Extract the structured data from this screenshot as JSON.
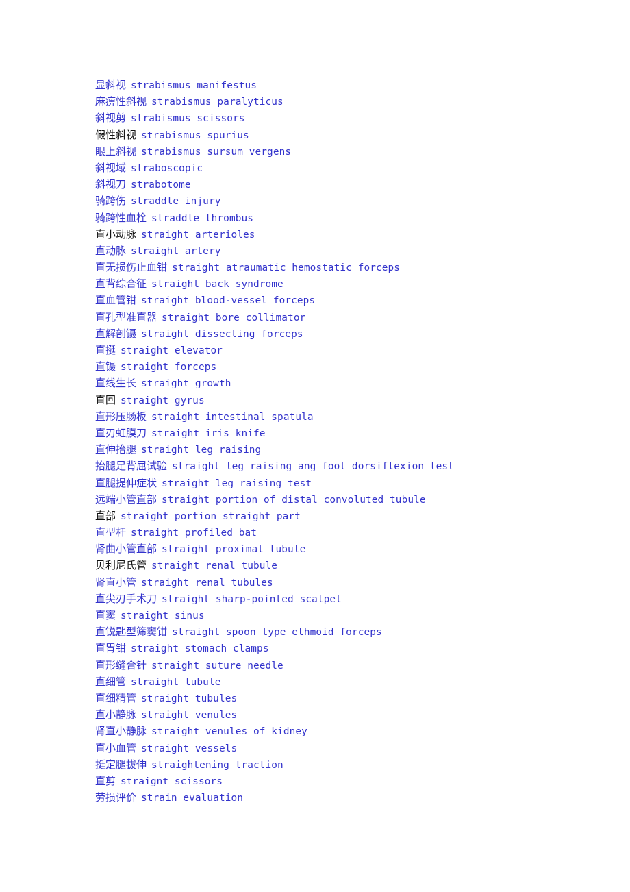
{
  "document": {
    "type": "bilingual-glossary",
    "language_pair": "Chinese-English",
    "text_color_blue": "#3333CC",
    "text_color_black": "#111111",
    "background_color": "#FFFFFF",
    "entry_count": 44
  },
  "entries": [
    {
      "term": "显斜视",
      "term_color": "blue",
      "gloss": "strabismus manifestus"
    },
    {
      "term": "麻痹性斜视",
      "term_color": "blue",
      "gloss": "strabismus paralyticus"
    },
    {
      "term": "斜视剪",
      "term_color": "blue",
      "gloss": "strabismus scissors"
    },
    {
      "term": "假性斜视",
      "term_color": "black",
      "gloss": "strabismus spurius"
    },
    {
      "term": "眼上斜视",
      "term_color": "blue",
      "gloss": "strabismus sursum vergens"
    },
    {
      "term": "斜视域",
      "term_color": "blue",
      "gloss": "straboscopic"
    },
    {
      "term": "斜视刀",
      "term_color": "blue",
      "gloss": "strabotome"
    },
    {
      "term": "骑跨伤",
      "term_color": "blue",
      "gloss": "straddle injury"
    },
    {
      "term": "骑跨性血栓",
      "term_color": "blue",
      "gloss": "straddle thrombus"
    },
    {
      "term": "直小动脉",
      "term_color": "black",
      "gloss": "straight arterioles"
    },
    {
      "term": "直动脉",
      "term_color": "blue",
      "gloss": "straight artery"
    },
    {
      "term": "直无损伤止血钳",
      "term_color": "blue",
      "gloss": "straight atraumatic hemostatic forceps"
    },
    {
      "term": "直背综合征",
      "term_color": "blue",
      "gloss": "straight back syndrome"
    },
    {
      "term": "直血管钳",
      "term_color": "blue",
      "gloss": "straight blood-vessel forceps"
    },
    {
      "term": "直孔型准直器",
      "term_color": "blue",
      "gloss": "straight bore collimator"
    },
    {
      "term": "直解剖镊",
      "term_color": "blue",
      "gloss": "straight dissecting forceps"
    },
    {
      "term": "直挺",
      "term_color": "blue",
      "gloss": "straight elevator"
    },
    {
      "term": "直镊",
      "term_color": "blue",
      "gloss": "straight forceps"
    },
    {
      "term": "直线生长",
      "term_color": "blue",
      "gloss": "straight growth"
    },
    {
      "term": "直回",
      "term_color": "black",
      "gloss": "straight gyrus"
    },
    {
      "term": "直形压肠板",
      "term_color": "blue",
      "gloss": "straight intestinal spatula"
    },
    {
      "term": "直刃虹膜刀",
      "term_color": "blue",
      "gloss": "straight iris knife"
    },
    {
      "term": "直伸抬腿",
      "term_color": "blue",
      "gloss": "straight leg raising"
    },
    {
      "term": "抬腿足背屈试验",
      "term_color": "blue",
      "gloss": "straight leg raising ang foot dorsiflexion test"
    },
    {
      "term": "直腿提伸症状",
      "term_color": "blue",
      "gloss": "straight leg raising test"
    },
    {
      "term": "远端小管直部",
      "term_color": "blue",
      "gloss": "straight portion of distal convoluted tubule"
    },
    {
      "term": "直部",
      "term_color": "black",
      "gloss": "straight portion straight part"
    },
    {
      "term": "直型杆",
      "term_color": "blue",
      "gloss": "straight profiled bat"
    },
    {
      "term": "肾曲小管直部",
      "term_color": "blue",
      "gloss": "straight proximal tubule"
    },
    {
      "term": "贝利尼氏管",
      "term_color": "black",
      "gloss": "straight renal tubule"
    },
    {
      "term": "肾直小管",
      "term_color": "blue",
      "gloss": "straight renal tubules"
    },
    {
      "term": "直尖刃手术刀",
      "term_color": "blue",
      "gloss": "straight sharp-pointed scalpel"
    },
    {
      "term": "直窦",
      "term_color": "blue",
      "gloss": "straight sinus"
    },
    {
      "term": "直锐匙型筛窦钳",
      "term_color": "blue",
      "gloss": "straight spoon type ethmoid forceps"
    },
    {
      "term": "直胃钳",
      "term_color": "blue",
      "gloss": "straight stomach clamps"
    },
    {
      "term": "直形缝合针",
      "term_color": "blue",
      "gloss": "straight suture needle"
    },
    {
      "term": "直细管",
      "term_color": "blue",
      "gloss": "straight tubule"
    },
    {
      "term": "直细精管",
      "term_color": "blue",
      "gloss": "straight tubules"
    },
    {
      "term": "直小静脉",
      "term_color": "blue",
      "gloss": "straight venules"
    },
    {
      "term": "肾直小静脉",
      "term_color": "blue",
      "gloss": "straight venules of kidney"
    },
    {
      "term": "直小血管",
      "term_color": "blue",
      "gloss": "straight vessels"
    },
    {
      "term": "挺定腿拔伸",
      "term_color": "blue",
      "gloss": "straightening traction"
    },
    {
      "term": "直剪",
      "term_color": "blue",
      "gloss": "straignt scissors"
    },
    {
      "term": "劳损评价",
      "term_color": "blue",
      "gloss": "strain evaluation"
    }
  ]
}
